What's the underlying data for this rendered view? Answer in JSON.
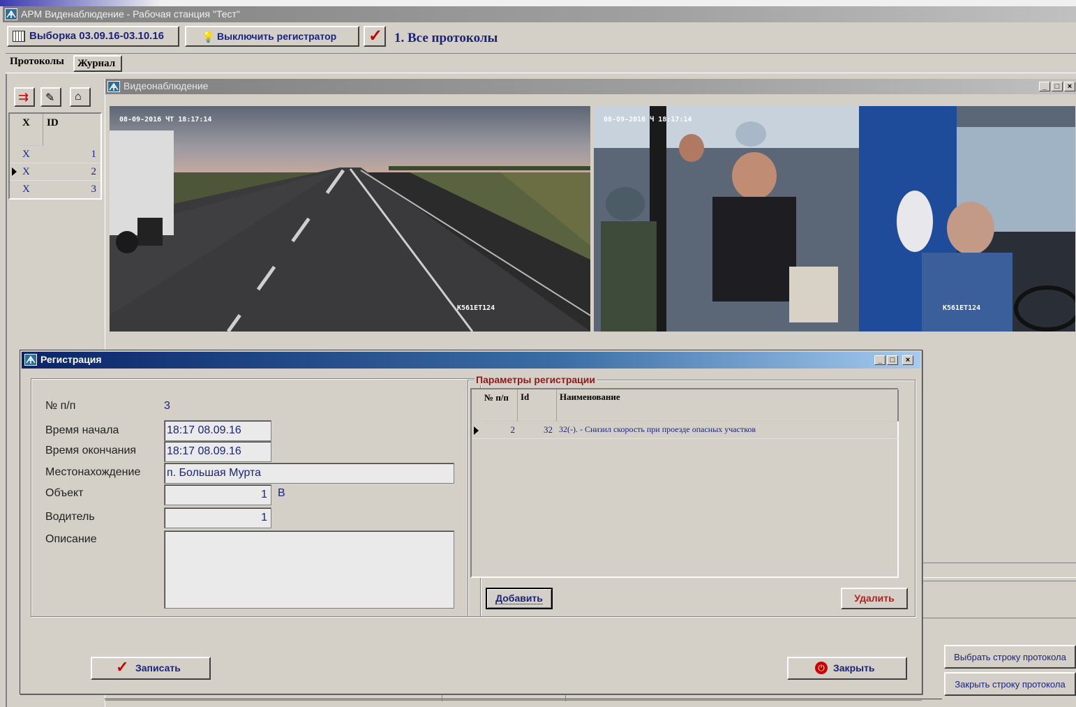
{
  "app": {
    "title": "АРМ Виденаблюдение - Рабочая станция \"Тест\"",
    "icon": "app-network-icon"
  },
  "toolbar": {
    "selection_label": "Выборка 03.09.16-03.10.16",
    "recorder_label": "Выключить регистратор",
    "filter_label": "1. Все протоколы"
  },
  "tabs": [
    {
      "label": "Протоколы"
    },
    {
      "label": "Журнал"
    }
  ],
  "left_grid": {
    "headers": [
      "X",
      "ID"
    ],
    "rows": [
      {
        "x": "X",
        "id": "1"
      },
      {
        "x": "X",
        "id": "2"
      },
      {
        "x": "X",
        "id": "3"
      }
    ]
  },
  "video_window": {
    "title": "Видеонаблюдение",
    "cam1_timestamp": "08-09-2016 ЧТ 18:17:14",
    "cam1_plate": "К561ЕТ124",
    "cam2_timestamp": "08-09-2016 Ч 18:17:14",
    "cam2_plate": "К561ЕТ124"
  },
  "registration": {
    "title": "Регистрация",
    "labels": {
      "num": "№ п/п",
      "start": "Время начала",
      "end": "Время окончания",
      "location": "Местонахождение",
      "object": "Объект",
      "driver": "Водитель",
      "description": "Описание"
    },
    "values": {
      "num": "3",
      "start": "18:17 08.09.16",
      "end": "18:17 08.09.16",
      "location": "п. Большая Мурта",
      "object": "1",
      "object_suffix": "В",
      "driver": "1",
      "description": ""
    },
    "params": {
      "title": "Параметры регистрации",
      "headers": [
        "№ п/п",
        "Id",
        "Наименование"
      ],
      "rows": [
        {
          "num": "2",
          "id": "32",
          "name": "32(-). - Снизил скорость при проезде опасных участков"
        }
      ]
    },
    "add_label": "Добавить",
    "delete_label": "Удалить",
    "save_label": "Записать",
    "close_label": "Закрыть"
  },
  "right_buttons": {
    "select_row": "Выбрать строку протокола",
    "close_row": "Закрыть строку протокола"
  },
  "colors": {
    "window_bg": "#d4d0c8",
    "title_active": "#0a246a",
    "text_blue": "#1a237e",
    "param_title": "#8b1a1a",
    "check_red": "#cc0000"
  }
}
